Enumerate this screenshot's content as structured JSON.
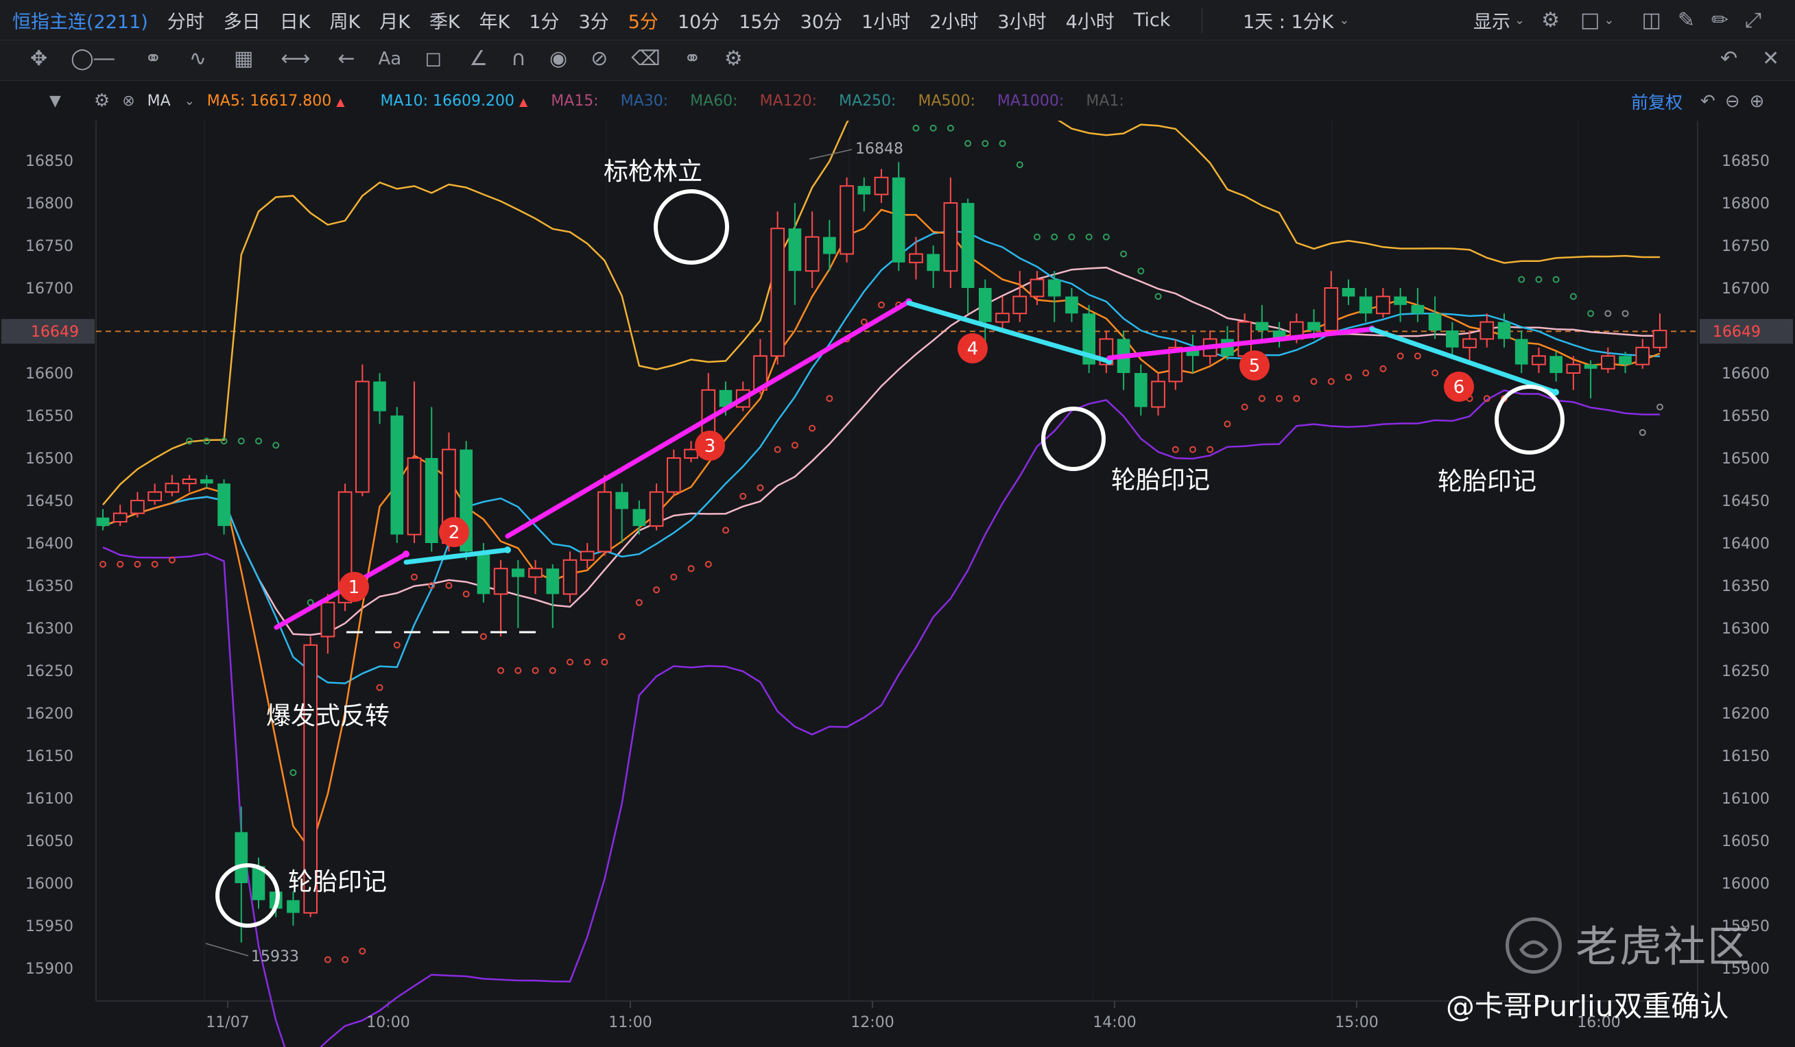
{
  "toolbar": {
    "instrument": "恒指主连(2211)",
    "periods": [
      "分时",
      "多日",
      "日K",
      "周K",
      "月K",
      "季K",
      "年K",
      "1分",
      "3分",
      "5分",
      "10分",
      "15分",
      "30分",
      "1小时",
      "2小时",
      "3小时",
      "4小时",
      "Tick"
    ],
    "active_period": "5分",
    "range_label": "1天 : 1分K",
    "display_label": "显示"
  },
  "indicator_bar": {
    "ma_label": "MA",
    "ma5": {
      "label": "MA5:",
      "value": "16617.800",
      "color": "#ff8a1f"
    },
    "ma10": {
      "label": "MA10:",
      "value": "16609.200",
      "color": "#2ab8ee"
    },
    "inactive": [
      {
        "label": "MA15:",
        "color": "#b04a7a"
      },
      {
        "label": "MA30:",
        "color": "#2a5e9e"
      },
      {
        "label": "MA60:",
        "color": "#2e7a55"
      },
      {
        "label": "MA120:",
        "color": "#a03a3a"
      },
      {
        "label": "MA250:",
        "color": "#2a8a8a"
      },
      {
        "label": "MA500:",
        "color": "#a07a2a"
      },
      {
        "label": "MA1000:",
        "color": "#6a3aa0"
      },
      {
        "label": "MA1:",
        "color": "#555"
      }
    ],
    "adjust_label": "前复权"
  },
  "annotations": {
    "burst": "爆发式反转",
    "spears": "标枪林立",
    "tire1": "轮胎印记",
    "tire2": "轮胎印记",
    "tire3": "轮胎印记",
    "nums": [
      "1",
      "2",
      "3",
      "4",
      "5",
      "6"
    ]
  },
  "watermark": {
    "brand": "老虎社区",
    "author": "@卡哥Purliu双重确认"
  },
  "chart_data": {
    "type": "candlestick",
    "ylim": [
      15870,
      16890
    ],
    "y_ticks": [
      16850,
      16800,
      16750,
      16700,
      16650,
      16600,
      16550,
      16500,
      16450,
      16400,
      16350,
      16300,
      16250,
      16200,
      16150,
      16100,
      16050,
      16000,
      15950,
      15900
    ],
    "current_price": 16649,
    "current_price_label": "16649",
    "x_tick_labels": [
      "11/07",
      "10:00",
      "11:00",
      "12:00",
      "14:00",
      "15:00",
      "16:00"
    ],
    "high_label": "16848",
    "low_label": "15933",
    "candles": [
      [
        16430,
        16420,
        16440,
        16415
      ],
      [
        16425,
        16435,
        16445,
        16420
      ],
      [
        16435,
        16450,
        16460,
        16430
      ],
      [
        16450,
        16460,
        16470,
        16445
      ],
      [
        16460,
        16470,
        16480,
        16455
      ],
      [
        16470,
        16475,
        16480,
        16460
      ],
      [
        16475,
        16470,
        16480,
        16465
      ],
      [
        16470,
        16420,
        16475,
        16410
      ],
      [
        16060,
        16000,
        16090,
        15930
      ],
      [
        16020,
        15980,
        16030,
        15970
      ],
      [
        15990,
        15970,
        16000,
        15960
      ],
      [
        15980,
        15965,
        15990,
        15950
      ],
      [
        15965,
        16280,
        16290,
        15960
      ],
      [
        16290,
        16330,
        16340,
        16270
      ],
      [
        16330,
        16460,
        16470,
        16320
      ],
      [
        16460,
        16590,
        16610,
        16455
      ],
      [
        16590,
        16555,
        16600,
        16540
      ],
      [
        16550,
        16410,
        16560,
        16400
      ],
      [
        16410,
        16500,
        16590,
        16400
      ],
      [
        16500,
        16400,
        16560,
        16390
      ],
      [
        16400,
        16510,
        16530,
        16390
      ],
      [
        16510,
        16390,
        16520,
        16380
      ],
      [
        16390,
        16340,
        16400,
        16330
      ],
      [
        16340,
        16370,
        16380,
        16290
      ],
      [
        16370,
        16360,
        16380,
        16300
      ],
      [
        16360,
        16370,
        16380,
        16340
      ],
      [
        16370,
        16340,
        16375,
        16300
      ],
      [
        16340,
        16380,
        16390,
        16330
      ],
      [
        16380,
        16390,
        16400,
        16370
      ],
      [
        16390,
        16460,
        16480,
        16385
      ],
      [
        16460,
        16440,
        16470,
        16400
      ],
      [
        16440,
        16420,
        16450,
        16410
      ],
      [
        16420,
        16460,
        16470,
        16415
      ],
      [
        16460,
        16500,
        16510,
        16455
      ],
      [
        16500,
        16510,
        16520,
        16495
      ],
      [
        16510,
        16580,
        16600,
        16505
      ],
      [
        16580,
        16560,
        16590,
        16550
      ],
      [
        16560,
        16580,
        16590,
        16555
      ],
      [
        16580,
        16620,
        16640,
        16575
      ],
      [
        16620,
        16770,
        16790,
        16610
      ],
      [
        16770,
        16720,
        16800,
        16680
      ],
      [
        16720,
        16760,
        16790,
        16700
      ],
      [
        16760,
        16740,
        16780,
        16720
      ],
      [
        16740,
        16820,
        16830,
        16730
      ],
      [
        16820,
        16810,
        16830,
        16790
      ],
      [
        16810,
        16830,
        16840,
        16800
      ],
      [
        16830,
        16730,
        16848,
        16720
      ],
      [
        16730,
        16740,
        16760,
        16710
      ],
      [
        16740,
        16720,
        16750,
        16700
      ],
      [
        16720,
        16800,
        16830,
        16700
      ],
      [
        16800,
        16700,
        16805,
        16670
      ],
      [
        16700,
        16660,
        16710,
        16620
      ],
      [
        16660,
        16670,
        16690,
        16650
      ],
      [
        16670,
        16690,
        16720,
        16660
      ],
      [
        16690,
        16710,
        16720,
        16680
      ],
      [
        16710,
        16690,
        16720,
        16660
      ],
      [
        16690,
        16670,
        16700,
        16660
      ],
      [
        16670,
        16610,
        16680,
        16600
      ],
      [
        16610,
        16640,
        16650,
        16600
      ],
      [
        16640,
        16600,
        16650,
        16580
      ],
      [
        16600,
        16560,
        16610,
        16550
      ],
      [
        16560,
        16590,
        16600,
        16550
      ],
      [
        16590,
        16630,
        16640,
        16580
      ],
      [
        16630,
        16620,
        16645,
        16600
      ],
      [
        16620,
        16640,
        16650,
        16610
      ],
      [
        16640,
        16620,
        16655,
        16615
      ],
      [
        16620,
        16660,
        16670,
        16610
      ],
      [
        16660,
        16650,
        16680,
        16640
      ],
      [
        16650,
        16640,
        16660,
        16630
      ],
      [
        16640,
        16660,
        16670,
        16635
      ],
      [
        16660,
        16650,
        16675,
        16640
      ],
      [
        16650,
        16700,
        16720,
        16645
      ],
      [
        16700,
        16690,
        16710,
        16680
      ],
      [
        16690,
        16670,
        16700,
        16660
      ],
      [
        16670,
        16690,
        16700,
        16665
      ],
      [
        16690,
        16680,
        16700,
        16660
      ],
      [
        16680,
        16670,
        16700,
        16660
      ],
      [
        16670,
        16650,
        16690,
        16640
      ],
      [
        16650,
        16630,
        16660,
        16620
      ],
      [
        16630,
        16640,
        16650,
        16610
      ],
      [
        16640,
        16660,
        16670,
        16630
      ],
      [
        16660,
        16640,
        16670,
        16630
      ],
      [
        16640,
        16610,
        16650,
        16600
      ],
      [
        16610,
        16620,
        16630,
        16600
      ],
      [
        16620,
        16600,
        16625,
        16590
      ],
      [
        16600,
        16610,
        16620,
        16580
      ],
      [
        16610,
        16605,
        16615,
        16570
      ],
      [
        16605,
        16620,
        16630,
        16600
      ],
      [
        16620,
        16610,
        16625,
        16600
      ],
      [
        16610,
        16630,
        16640,
        16605
      ],
      [
        16630,
        16650,
        16670,
        16625
      ]
    ]
  }
}
